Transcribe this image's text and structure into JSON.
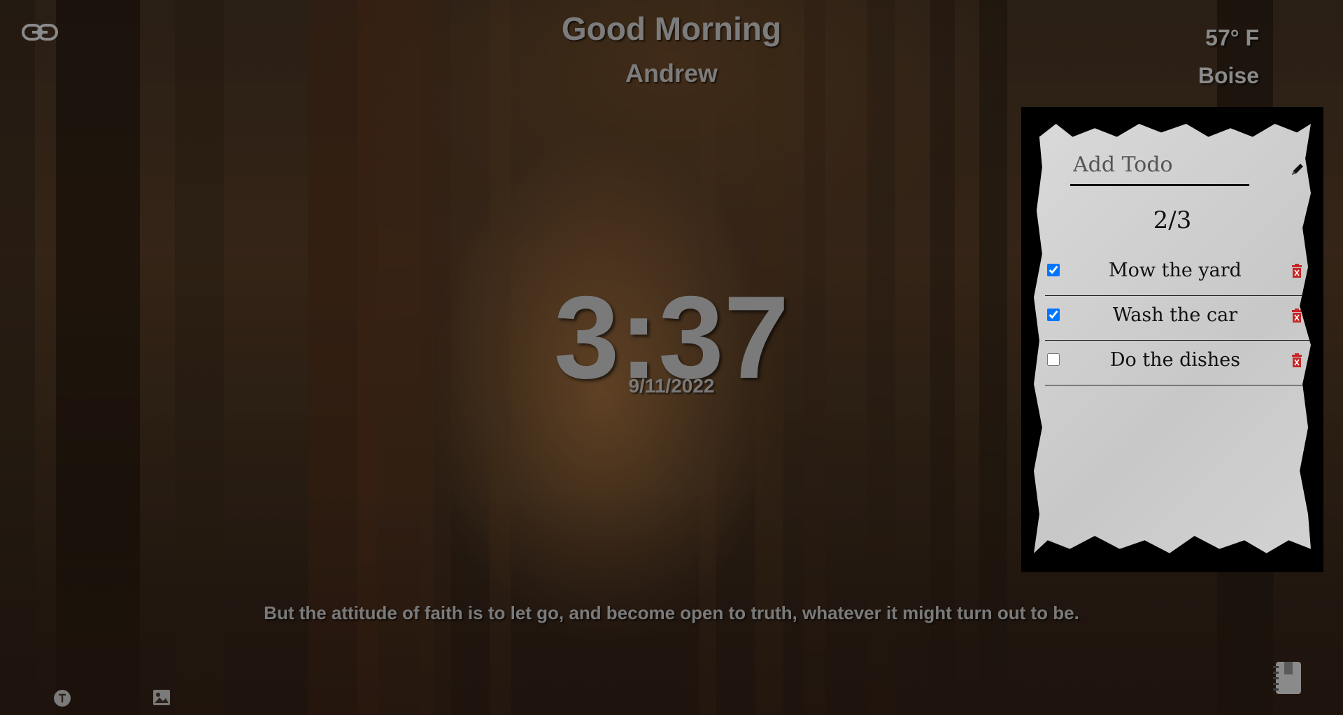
{
  "greeting": {
    "salutation": "Good Morning",
    "name": "Andrew"
  },
  "clock": {
    "time": "3:37",
    "date": "9/11/2022"
  },
  "weather": {
    "temperature": "57° F",
    "city": "Boise"
  },
  "quote": {
    "text": "But the attitude of faith is to let go, and become open to truth, whatever it might turn out to be."
  },
  "todo": {
    "input_placeholder": "Add Todo",
    "input_value": "",
    "completed_count": "2/3",
    "items": [
      {
        "label": "Mow the yard",
        "done": true
      },
      {
        "label": "Wash the car",
        "done": true
      },
      {
        "label": "Do the dishes",
        "done": false
      }
    ]
  },
  "icons": {
    "link": "link-icon",
    "edit": "pencil-icon",
    "delete": "trash-icon",
    "text_toggle": "text-icon",
    "image": "image-icon",
    "notes": "notebook-icon"
  },
  "colors": {
    "text_gray": "#7a7a7a",
    "delete_red": "#c62828",
    "checkbox_blue": "#1a73e8",
    "panel_black": "#000000",
    "paper": "#d4d4d4"
  }
}
